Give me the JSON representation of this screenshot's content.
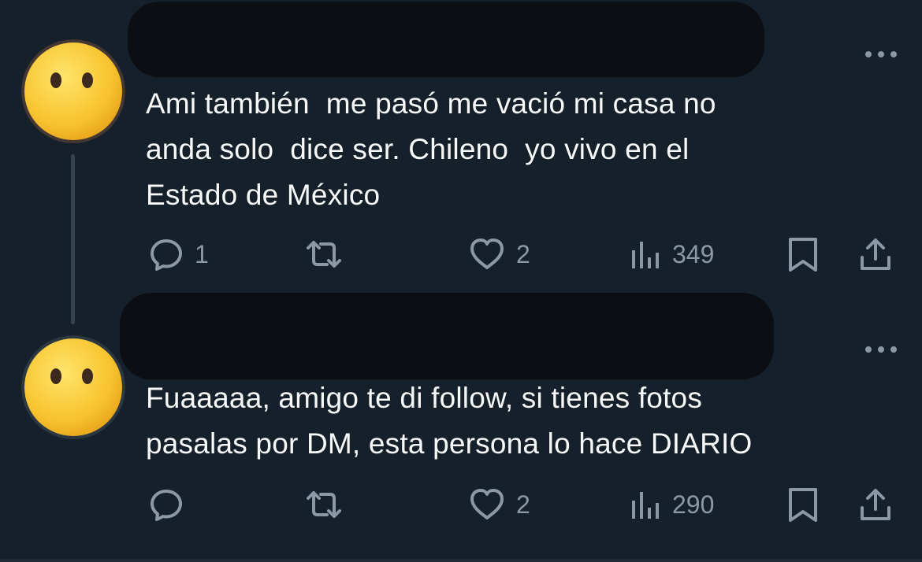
{
  "tweets": [
    {
      "text": "Ami también  me pasó me vació mi casa no\nanda solo  dice ser. Chileno  yo vivo en el\nEstado de México",
      "reply_count": "1",
      "retweet_count": "",
      "like_count": "2",
      "view_count": "349"
    },
    {
      "text": "Fuaaaaa, amigo te di follow, si tienes fotos\npasalas por DM, esta persona lo hace DIARIO",
      "reply_count": "",
      "retweet_count": "",
      "like_count": "2",
      "view_count": "290"
    }
  ],
  "icons": {
    "avatar": "face-without-mouth-emoji",
    "more": "more-horizontal-icon",
    "reply": "reply-icon",
    "retweet": "retweet-icon",
    "like": "heart-icon",
    "views": "views-icon",
    "bookmark": "bookmark-icon",
    "share": "share-icon"
  },
  "colors": {
    "background": "#15202b",
    "text": "#f7f9f9",
    "secondary": "#8b98a5",
    "redaction": "#0b0f13",
    "thread_line": "#38444d"
  }
}
